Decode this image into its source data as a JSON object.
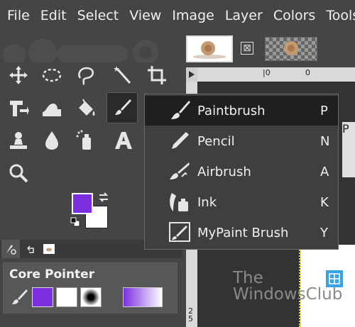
{
  "menubar": {
    "items": [
      "File",
      "Edit",
      "Select",
      "View",
      "Image",
      "Layer",
      "Colors",
      "Tools"
    ]
  },
  "colors": {
    "foreground": "#7b2fe1",
    "background": "#ffffff"
  },
  "toolbox": {
    "tools": [
      {
        "name": "move-tool-icon"
      },
      {
        "name": "ellipse-select-icon"
      },
      {
        "name": "free-select-icon"
      },
      {
        "name": "fuzzy-select-icon"
      },
      {
        "name": "crop-icon"
      },
      {
        "name": "unified-transform-icon"
      },
      {
        "name": "warp-transform-icon"
      },
      {
        "name": "bucket-fill-icon"
      },
      {
        "name": "paintbrush-icon"
      },
      {
        "name": "clone-icon"
      },
      {
        "name": "blur-icon"
      },
      {
        "name": "dodge-icon"
      },
      {
        "name": "text-icon"
      },
      {
        "name": "zoom-icon"
      }
    ]
  },
  "tool_options": {
    "title": "Core Pointer"
  },
  "popup": {
    "items": [
      {
        "label": "Paintbrush",
        "shortcut": "P",
        "icon": "paintbrush-icon",
        "selected": true
      },
      {
        "label": "Pencil",
        "shortcut": "N",
        "icon": "pencil-icon",
        "selected": false
      },
      {
        "label": "Airbrush",
        "shortcut": "A",
        "icon": "airbrush-icon",
        "selected": false
      },
      {
        "label": "Ink",
        "shortcut": "K",
        "icon": "ink-icon",
        "selected": false
      },
      {
        "label": "MyPaint Brush",
        "shortcut": "Y",
        "icon": "mypaint-brush-icon",
        "selected": false
      }
    ]
  },
  "rulers": {
    "top_left": "|0",
    "top_right": "0",
    "left": "2 5"
  },
  "side_panel": {
    "letter": "P"
  },
  "watermark": {
    "line1": "The",
    "line2": "WindowsClub"
  }
}
